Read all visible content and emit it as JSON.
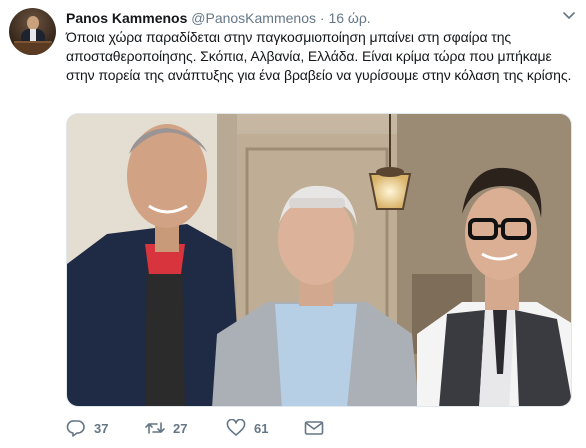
{
  "tweet": {
    "author_name": "Panos Kammenos",
    "handle": "@PanosKammenos",
    "separator": "·",
    "timestamp": "16 ώρ.",
    "text": "Όποια χώρα παραδίδεται στην παγκοσμιοποίηση μπαίνει στη σφαίρα της αποσταθεροποίησης. Σκόπια, Αλβανία, Ελλάδα. Είναι κρίμα τώρα που μπήκαμε στην πορεία της ανάπτυξης για ένα βραβείο να γυρίσουμε στην κόλαση της κρίσης.",
    "counts": {
      "replies": "37",
      "retweets": "27",
      "likes": "61"
    }
  },
  "icons": {
    "menu": "chevron-down-icon",
    "reply": "reply-icon",
    "retweet": "retweet-icon",
    "like": "heart-icon",
    "message": "envelope-icon"
  },
  "colors": {
    "text_primary": "#14171a",
    "text_secondary": "#657786",
    "border": "#e1e8ed"
  }
}
